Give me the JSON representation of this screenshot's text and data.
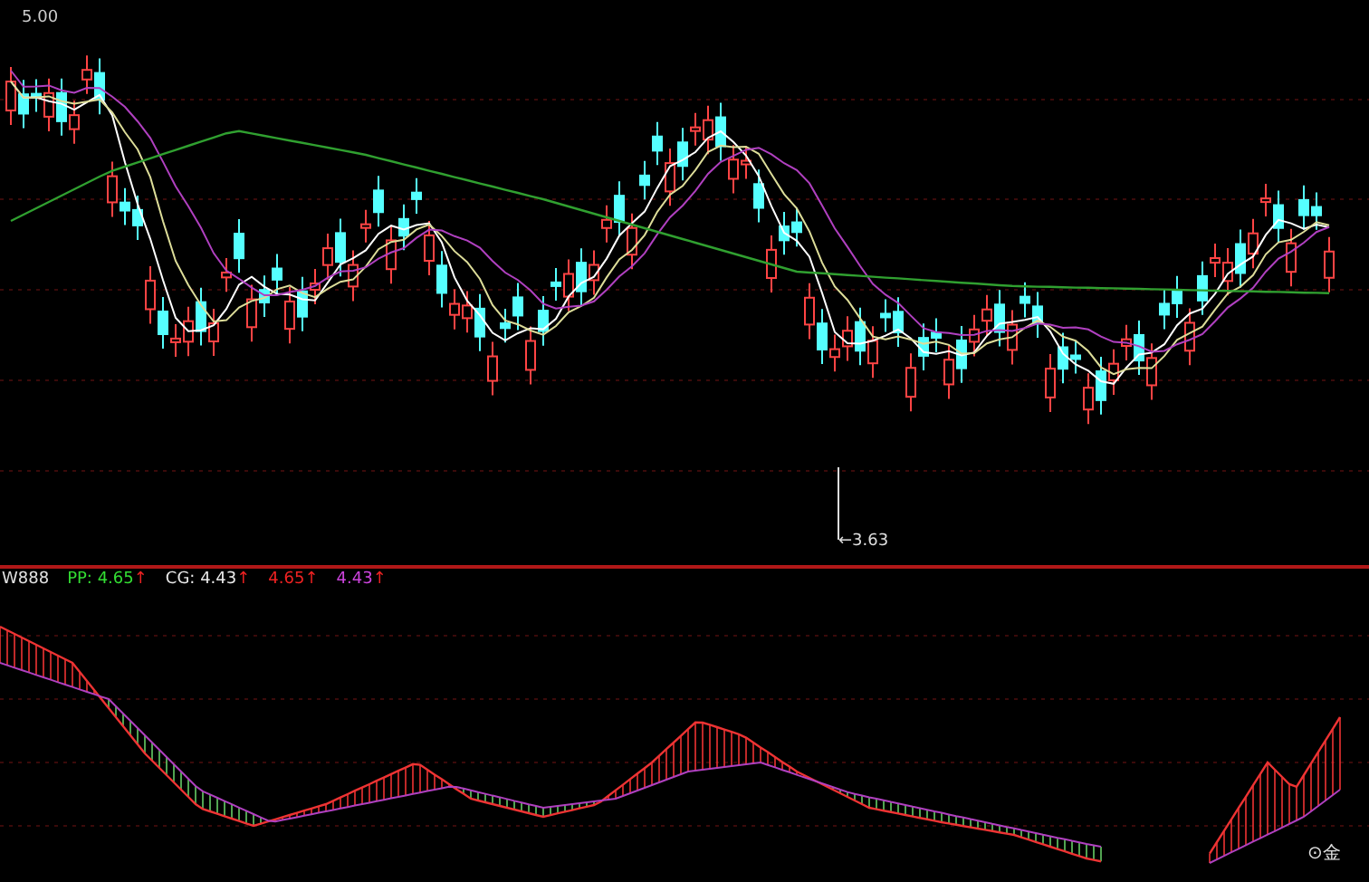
{
  "main_chart": {
    "price_label": "5.00",
    "low_marker": "←3.63"
  },
  "indicator": {
    "name": "W888",
    "readings": [
      {
        "label": "PP:",
        "value": "4.65",
        "arrow": "↑",
        "color": "#33dd33"
      },
      {
        "label": "CG:",
        "value": "4.43",
        "arrow": "↑",
        "color": "#e8e8e8"
      },
      {
        "value": "4.65",
        "arrow": "↑",
        "color": "#ee2222"
      },
      {
        "value": "4.43",
        "arrow": "↑",
        "color": "#cc44dd"
      }
    ],
    "signal": "⊙金"
  }
}
